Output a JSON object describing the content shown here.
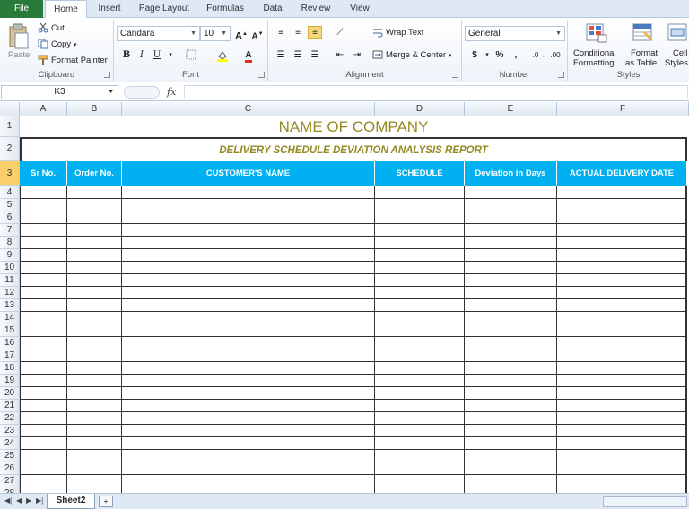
{
  "tabs": [
    "File",
    "Home",
    "Insert",
    "Page Layout",
    "Formulas",
    "Data",
    "Review",
    "View"
  ],
  "clipboard": {
    "label": "Clipboard",
    "paste": "Paste",
    "cut": "Cut",
    "copy": "Copy",
    "format_painter": "Format Painter"
  },
  "font": {
    "label": "Font",
    "name": "Candara",
    "size": "10"
  },
  "alignment": {
    "label": "Alignment",
    "wrap_text": "Wrap Text",
    "merge_center": "Merge & Center"
  },
  "number": {
    "label": "Number",
    "format": "General"
  },
  "styles": {
    "label": "Styles",
    "conditional": "Conditional",
    "conditional2": "Formatting",
    "format_as": "Format",
    "format_as2": "as Table",
    "cell": "Cell",
    "cell2": "Styles"
  },
  "formula_bar": {
    "name_box": "K3",
    "fx": "fx"
  },
  "columns": [
    "A",
    "B",
    "C",
    "D",
    "E",
    "F"
  ],
  "rows": [
    "1",
    "2",
    "3",
    "4",
    "5",
    "6",
    "7",
    "8",
    "9",
    "10",
    "11",
    "12",
    "13",
    "14",
    "15",
    "16",
    "17",
    "18",
    "19",
    "20",
    "21",
    "22",
    "23",
    "24",
    "25",
    "26",
    "27",
    "28"
  ],
  "sheet": {
    "company": "NAME OF COMPANY",
    "report_title": "DELIVERY SCHEDULE DEVIATION ANALYSIS REPORT",
    "headers": [
      "Sr No.",
      "Order No.",
      "CUSTOMER'S NAME",
      "SCHEDULE DELIVERY",
      "Deviation in Days",
      "ACTUAL DELIVERY DATE"
    ]
  },
  "sheet_tab": "Sheet2",
  "colors": {
    "header_fill": "#00b0f0",
    "title_color": "#948a21",
    "file_tab": "#2a7a3a"
  }
}
